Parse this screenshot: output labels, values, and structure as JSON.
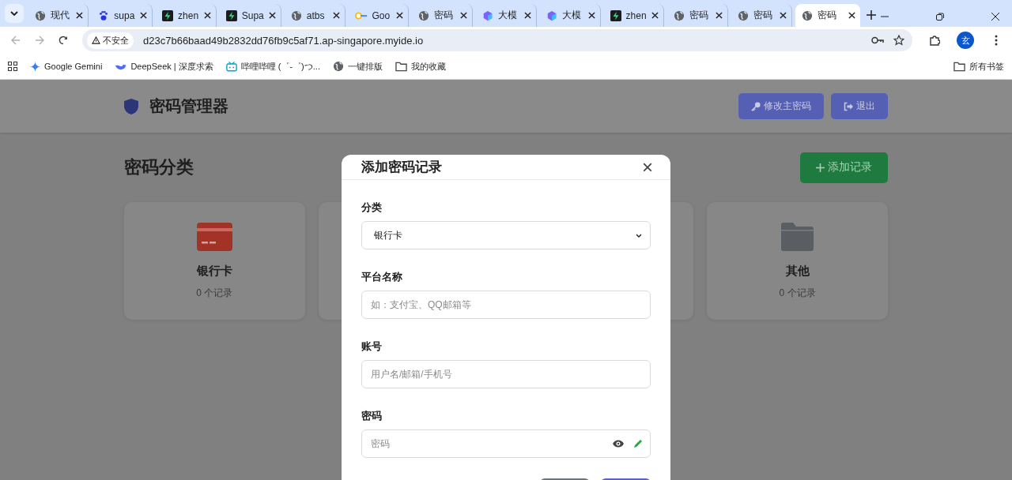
{
  "browser": {
    "tabs": [
      {
        "title": "现代",
        "kind": "globe",
        "selected": false
      },
      {
        "title": "supa",
        "kind": "paw",
        "selected": false
      },
      {
        "title": "zhen",
        "kind": "bolt",
        "selected": false
      },
      {
        "title": "Supa",
        "kind": "bolt",
        "selected": false
      },
      {
        "title": "atbs",
        "kind": "globe",
        "selected": false
      },
      {
        "title": "Goo",
        "kind": "key",
        "selected": false
      },
      {
        "title": "密码",
        "kind": "globe",
        "selected": false
      },
      {
        "title": "大模",
        "kind": "cube",
        "selected": false
      },
      {
        "title": "大模",
        "kind": "cube",
        "selected": false
      },
      {
        "title": "zhen",
        "kind": "bolt",
        "selected": false
      },
      {
        "title": "密码",
        "kind": "globe",
        "selected": false
      },
      {
        "title": "密码",
        "kind": "globe",
        "selected": false
      },
      {
        "title": "密码",
        "kind": "globe",
        "selected": true
      }
    ],
    "security": "不安全",
    "url": "d23c7b66baad49b2832dd76fb9c5af71.ap-singapore.myide.io",
    "profile": "玄",
    "bookmarks": [
      {
        "label": "Google Gemini",
        "kind": "sparkle"
      },
      {
        "label": "DeepSeek | 深度求索",
        "kind": "whale"
      },
      {
        "label": "哔哩哔哩 (゜-゜)つ...",
        "kind": "tv"
      },
      {
        "label": "一键排版",
        "kind": "globe"
      },
      {
        "label": "我的收藏",
        "kind": "folder"
      }
    ],
    "all_bookmarks": "所有书签"
  },
  "app": {
    "title": "密码管理器",
    "header_buttons": [
      {
        "label": "修改主密码",
        "kind": "key"
      },
      {
        "label": "退出",
        "kind": "logout"
      }
    ],
    "section_title": "密码分类",
    "add_button": "添加记录",
    "categories": [
      {
        "name": "银行卡",
        "count": "0 个记录",
        "kind": "card",
        "color": "#a33327"
      },
      {
        "name": "其他",
        "count": "0 个记录",
        "kind": "folder",
        "color": "#5a5e62"
      }
    ]
  },
  "modal": {
    "title": "添加密码记录",
    "close": "×",
    "fields": [
      {
        "kind": "select",
        "label": "分类",
        "value": "银行卡"
      },
      {
        "kind": "text",
        "label": "平台名称",
        "placeholder": "如：支付宝、QQ邮箱等"
      },
      {
        "kind": "text",
        "label": "账号",
        "placeholder": "用户名/邮箱/手机号"
      },
      {
        "kind": "password",
        "label": "密码",
        "placeholder": "密码"
      }
    ]
  }
}
